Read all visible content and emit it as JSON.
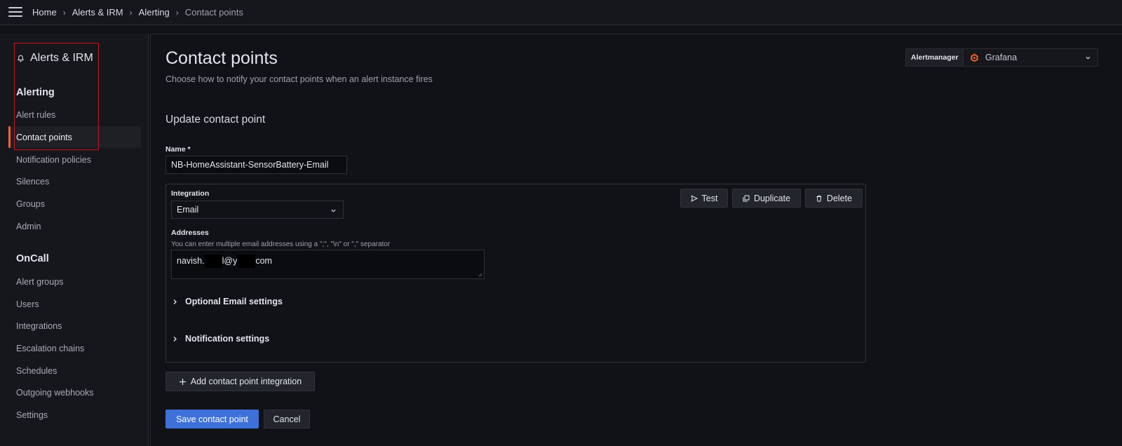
{
  "breadcrumb": [
    "Home",
    "Alerts & IRM",
    "Alerting",
    "Contact points"
  ],
  "sidebar": {
    "header": "Alerts & IRM",
    "groups": [
      {
        "title": "Alerting",
        "items": [
          "Alert rules",
          "Contact points",
          "Notification policies",
          "Silences",
          "Groups",
          "Admin"
        ]
      },
      {
        "title": "OnCall",
        "items": [
          "Alert groups",
          "Users",
          "Integrations",
          "Escalation chains",
          "Schedules",
          "Outgoing webhooks",
          "Settings"
        ]
      }
    ],
    "active_item": "Contact points"
  },
  "page": {
    "title": "Contact points",
    "subtitle": "Choose how to notify your contact points when an alert instance fires"
  },
  "alertmanager": {
    "label": "Alertmanager",
    "selected": "Grafana"
  },
  "form": {
    "section_title": "Update contact point",
    "name_label": "Name *",
    "name_value": "NB-HomeAssistant-SensorBattery-Email",
    "integration": {
      "label": "Integration",
      "selected": "Email",
      "addresses_label": "Addresses",
      "addresses_help": "You can enter multiple email addresses using a \";\", \"\\n\" or \",\" separator",
      "addresses_parts": [
        "navish.",
        "l@y",
        "com"
      ],
      "optional_label": "Optional Email settings",
      "notification_label": "Notification settings",
      "test_label": "Test",
      "duplicate_label": "Duplicate",
      "delete_label": "Delete"
    },
    "add_integration_label": "Add contact point integration",
    "save_label": "Save contact point",
    "cancel_label": "Cancel"
  },
  "colors": {
    "accent": "#f2652b",
    "primary": "#3d71d9",
    "highlight": "#c4161c"
  }
}
